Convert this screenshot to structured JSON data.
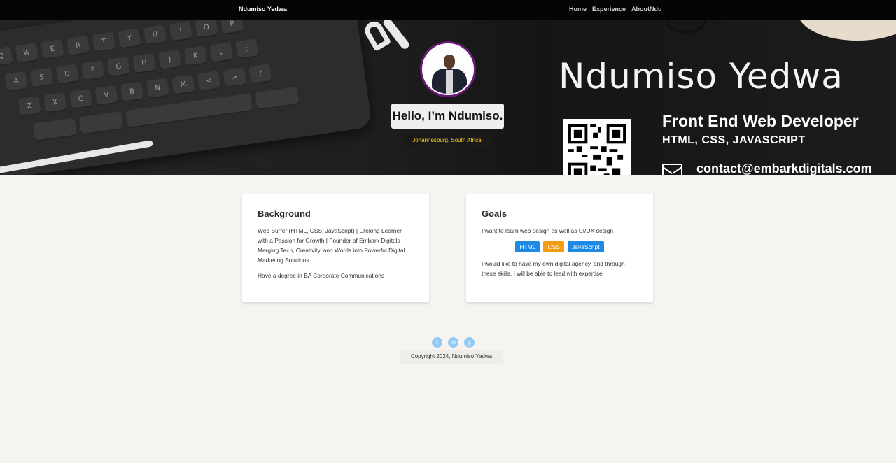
{
  "nav": {
    "brand": "Ndumiso Yedwa",
    "links": [
      "Home",
      "Experience",
      "AboutNdu"
    ]
  },
  "hero": {
    "banner_name": "Ndumiso Yedwa",
    "banner_role": "Front End Web Developer",
    "banner_skills": "HTML, CSS, JAVASCRIPT",
    "banner_contact": "contact@embarkdigitals.com",
    "greeting": "Hello, I’m Ndumiso.",
    "location": "Johannesburg, South Africa.",
    "keyboard_keys": {
      "row1": [
        "Q",
        "W",
        "E",
        "R",
        "T",
        "Y",
        "U",
        "I",
        "O",
        "P"
      ],
      "row2": [
        "A",
        "S",
        "D",
        "F",
        "G",
        "H",
        "J",
        "K",
        "L",
        ";"
      ],
      "row3": [
        "Z",
        "X",
        "C",
        "V",
        "B",
        "N",
        "M",
        "<",
        ">",
        "?"
      ]
    }
  },
  "background": {
    "title": "Background",
    "paragraph1": "Web Surfer (HTML, CSS, JavaScript) | Lifelong Learner with a Passion for Growth | Founder of Embark Digitals - Merging Tech, Creativity, and Words into Powerful Digital Marketing Solutions.",
    "paragraph2": "Have a degree in BA Corporate Communications"
  },
  "goals": {
    "title": "Goals",
    "paragraph1": "I want to learn web design as well as UI/UX design",
    "tags": [
      {
        "label": "HTML",
        "color": "#1e88e5"
      },
      {
        "label": "CSS",
        "color": "#f39c12"
      },
      {
        "label": "JavaScript",
        "color": "#1e88e5"
      }
    ],
    "paragraph2": "I would like to have my own digital agency, and through these skills, I will be able to lead with expertise"
  },
  "footer": {
    "social_icons": [
      "twitter-icon",
      "linkedin-icon",
      "github-icon"
    ],
    "copyright": "Copyright 2024, Ndumiso Yedwa"
  },
  "colors": {
    "nav_bg": "#050505",
    "page_bg": "#f5f4f0",
    "location_text": "#ffd21f",
    "avatar_border": "#6a1b7a",
    "social_icon": "#90caf5"
  }
}
